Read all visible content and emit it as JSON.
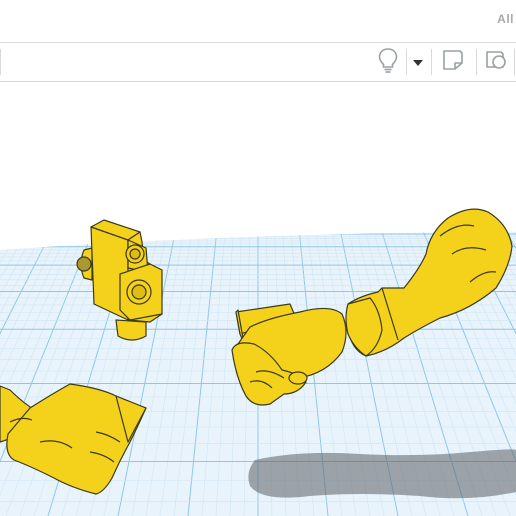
{
  "header": {
    "corner_text": "All"
  },
  "toolbar": {
    "tools": [
      {
        "name": "lightbulb-icon"
      },
      {
        "name": "dropdown-caret-icon"
      },
      {
        "name": "note-shape-icon"
      },
      {
        "name": "view-shape-icon"
      }
    ]
  },
  "workplane": {
    "grid_color": "#8fc7e8",
    "grid_minor_color": "#cfe6f5",
    "plane_color": "#e9f3fb",
    "objects": [
      {
        "name": "robot-head-part",
        "color": "#f4d21c"
      },
      {
        "name": "fist-part",
        "color": "#f4d21c"
      },
      {
        "name": "forearm-part",
        "color": "#f4d21c"
      },
      {
        "name": "hand-part",
        "color": "#f4d21c"
      }
    ]
  }
}
